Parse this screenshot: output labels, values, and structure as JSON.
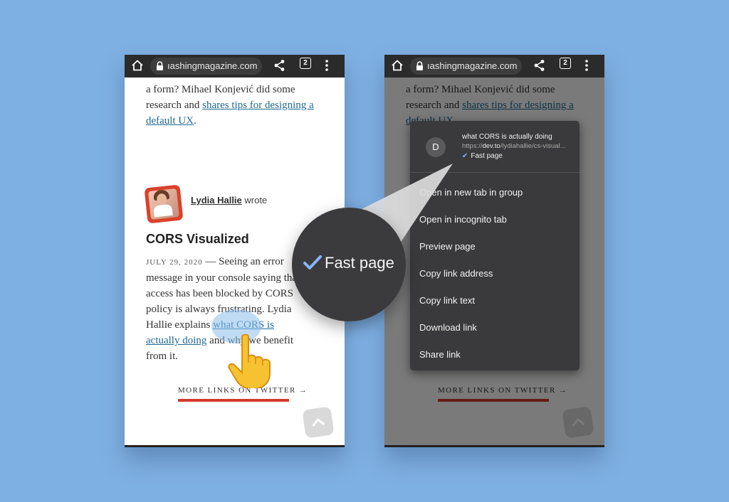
{
  "browser": {
    "url": "ıashingmagazine.com",
    "tab_count": "2"
  },
  "article": {
    "intro_text": "a form? Mihael Konjević did some research and ",
    "intro_link": "shares tips for designing a default UX",
    "intro_end": ".",
    "author_name": "Lydia Hallie",
    "author_suffix": " wrote",
    "title": "CORS Visualized",
    "date": "JULY 29, 2020",
    "dash": " — ",
    "body_text": "Seeing an error message in your console saying that access has been blocked by CORS policy is always frustrating. Lydia Hallie explains ",
    "body_link": "what CORS is actually doing",
    "body_end": " and why we benefit from it.",
    "more_links": "MORE LINKS ON TWITTER →"
  },
  "context_menu": {
    "avatar_letter": "D",
    "title": "what CORS is actually doing",
    "url_prefix": "https://",
    "url_domain": "dev.to",
    "url_rest": "/lydiahallie/cs-visual...",
    "fast_page": "Fast page",
    "items": [
      "Open in new tab in group",
      "Open in incognito tab",
      "Preview page",
      "Copy link address",
      "Copy link text",
      "Download link",
      "Share link"
    ]
  },
  "magnifier": {
    "label": "Fast page"
  },
  "colors": {
    "background": "#7fb0e3",
    "link": "#1e6a93",
    "accent_bar": "#d33a2b",
    "check": "#8ab4f8"
  },
  "icons": [
    "home-icon",
    "lock-icon",
    "share-icon",
    "tab-switcher-icon",
    "overflow-menu-icon",
    "check-icon",
    "chevron-up-icon",
    "pointing-hand-icon"
  ]
}
